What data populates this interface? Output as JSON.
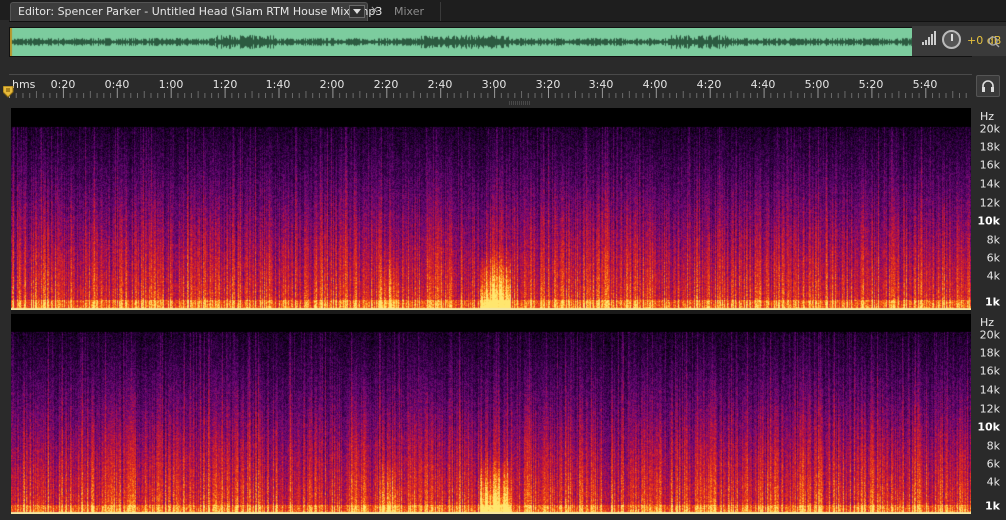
{
  "tabs": {
    "editor_title": "Editor: Spencer Parker - Untitled Head (Slam RTM House Mix).mp3",
    "close_glyph": "×",
    "mixer_label": "Mixer"
  },
  "hud": {
    "volume_label": "+0 dB"
  },
  "ruler": {
    "unit_label": "hms",
    "ticks": [
      "0:20",
      "0:40",
      "1:00",
      "1:20",
      "1:40",
      "2:00",
      "2:20",
      "2:40",
      "3:00",
      "3:20",
      "3:40",
      "4:00",
      "4:20",
      "4:40",
      "5:00",
      "5:20",
      "5:40"
    ]
  },
  "frequency_scale": {
    "unit": "Hz",
    "labels": [
      {
        "text": "20k",
        "bold": false
      },
      {
        "text": "18k",
        "bold": false
      },
      {
        "text": "16k",
        "bold": false
      },
      {
        "text": "14k",
        "bold": false
      },
      {
        "text": "12k",
        "bold": false
      },
      {
        "text": "10k",
        "bold": true
      },
      {
        "text": "8k",
        "bold": false
      },
      {
        "text": "6k",
        "bold": false
      },
      {
        "text": "4k",
        "bold": false
      },
      {
        "text": "1k",
        "bold": true
      }
    ]
  },
  "colors": {
    "overview_waveform": "#7ccc9e",
    "hud_accent": "#e7c23d",
    "spectral_hot": "#ffd75a",
    "spectral_cool": "#3a0a6a"
  },
  "icons": {
    "tab_menu": "chevron-down-icon",
    "headphones": "headphones-icon",
    "volume_knob": "knob-icon",
    "playhead": "playhead-icon"
  }
}
